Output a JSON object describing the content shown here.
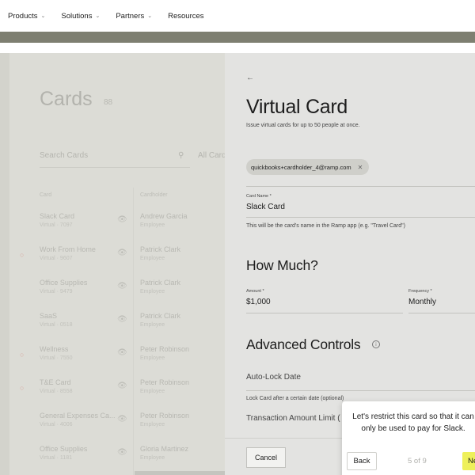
{
  "nav": {
    "items": [
      {
        "label": "Products",
        "has_dropdown": true
      },
      {
        "label": "Solutions",
        "has_dropdown": true
      },
      {
        "label": "Partners",
        "has_dropdown": true
      },
      {
        "label": "Resources",
        "has_dropdown": false
      }
    ],
    "band_color": "#7e7f71"
  },
  "background_app": {
    "title": "Cards",
    "count": "88",
    "search_placeholder": "Search Cards",
    "filter_label": "All Cards",
    "columns": {
      "card": "Card",
      "cardholder": "Cardholder"
    },
    "rows": [
      {
        "card_name": "Slack Card",
        "card_sub": "Virtual · 7097",
        "holder": "Andrew Garcia",
        "holder_role": "Employee",
        "locked": false
      },
      {
        "card_name": "Work From Home",
        "card_sub": "Virtual · 9607",
        "holder": "Patrick Clark",
        "holder_role": "Employee",
        "locked": true
      },
      {
        "card_name": "Office Supplies",
        "card_sub": "Virtual · 9479",
        "holder": "Patrick Clark",
        "holder_role": "Employee",
        "locked": false
      },
      {
        "card_name": "SaaS",
        "card_sub": "Virtual · 0518",
        "holder": "Patrick Clark",
        "holder_role": "Employee",
        "locked": false
      },
      {
        "card_name": "Wellness",
        "card_sub": "Virtual · 7550",
        "holder": "Peter Robinson",
        "holder_role": "Employee",
        "locked": true
      },
      {
        "card_name": "T&E Card",
        "card_sub": "Virtual · 8558",
        "holder": "Peter Robinson",
        "holder_role": "Employee",
        "locked": true
      },
      {
        "card_name": "General Expenses Ca...",
        "card_sub": "Virtual · 4006",
        "holder": "Peter Robinson",
        "holder_role": "Employee",
        "locked": false
      },
      {
        "card_name": "Office Supplies",
        "card_sub": "Virtual · 1181",
        "holder": "Gloria Martinez",
        "holder_role": "Employee",
        "locked": false
      }
    ]
  },
  "drawer": {
    "back_icon": "arrow-left-icon",
    "title": "Virtual Card",
    "subtitle": "Issue virtual cards for up to 50 people at once.",
    "recipient_chip": "quickbooks+cardholder_4@ramp.com",
    "card_name": {
      "label": "Card Name *",
      "value": "Slack Card",
      "hint": "This will be the card's name in the Ramp app (e.g. \"Travel Card\")"
    },
    "how_much": {
      "heading": "How Much?",
      "amount_label": "Amount *",
      "amount_value": "$1,000",
      "frequency_label": "Frequency *",
      "frequency_value": "Monthly"
    },
    "advanced": {
      "heading": "Advanced Controls",
      "auto_lock_label": "Auto-Lock Date",
      "lock_hint": "Lock Card after a certain date (optional)",
      "txn_limit_label": "Transaction Amount Limit ("
    },
    "footer": {
      "cancel_label": "Cancel"
    }
  },
  "tour": {
    "text": "Let's restrict this card so that it can only be used to pay for Slack.",
    "back_label": "Back",
    "step": "5 of 9",
    "next_label": "Next",
    "next_color": "#eef05a"
  }
}
